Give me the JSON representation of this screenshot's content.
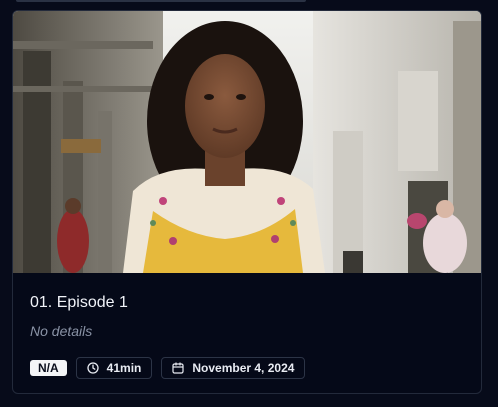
{
  "episode": {
    "title": "01. Episode 1",
    "details": "No details",
    "rating": "N/A",
    "runtime": "41min",
    "air_date": "November 4, 2024",
    "thumbnail": "woman-in-yellow-top-on-city-street"
  },
  "icons": {
    "runtime": "clock-icon",
    "air_date": "calendar-icon"
  },
  "colors": {
    "background": "#070b1a",
    "card_border": "#232a3b",
    "title_text": "#f1f3f8",
    "muted_text": "#8a93a6",
    "rating_badge": "#f4f5f7"
  }
}
